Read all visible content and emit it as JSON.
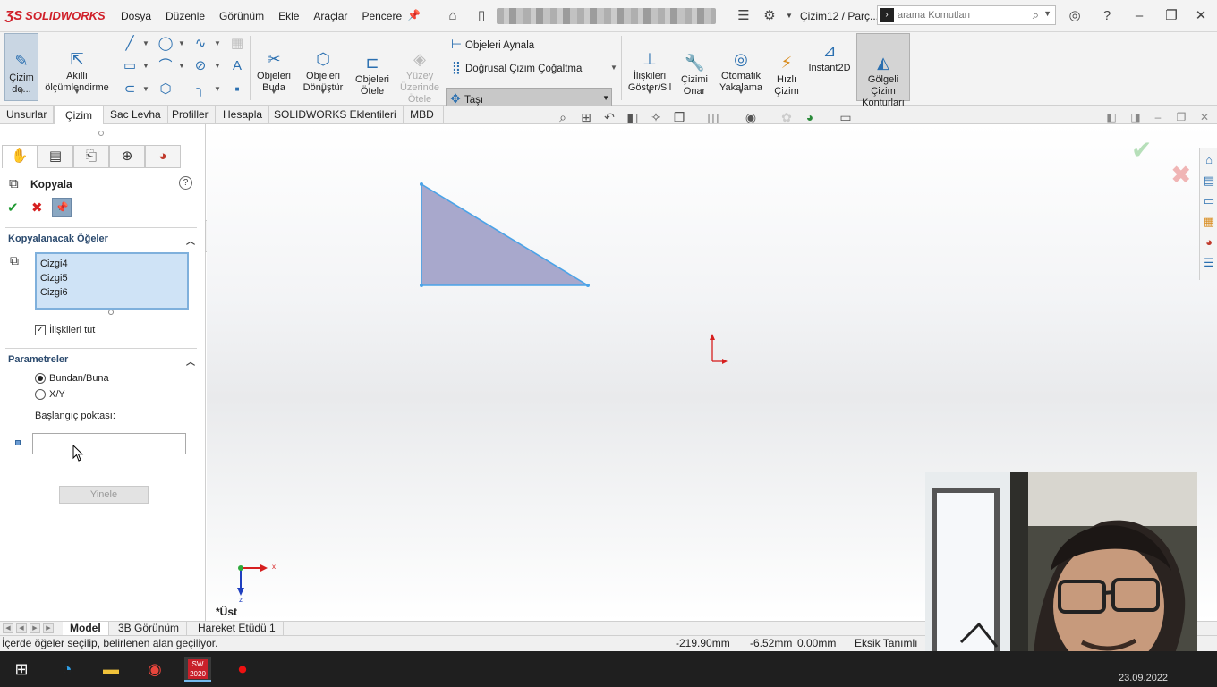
{
  "app": {
    "brand": "SOLIDWORKS",
    "brand_color": "#d0202a"
  },
  "menus": [
    "Dosya",
    "Düzenle",
    "Görünüm",
    "Ekle",
    "Araçlar",
    "Pencere"
  ],
  "titlebar": {
    "document_title": "Çizim12 / Parç...",
    "search_placeholder": "arama Komutları",
    "search_value": "arama Komutları"
  },
  "ribbon": {
    "sketch": "Çizim\nde...",
    "smart_dim": "Akıllı\nölçümlendirme",
    "trim": "Objeleri\nBuda",
    "convert": "Objeleri\nDönüştür",
    "offset": "Objeleri\nÖtele",
    "surface_offset": "Yüzey\nÜzerinde\nÖtele",
    "mirror": "Objeleri Aynala",
    "linear_pattern": "Doğrusal Çizim Çoğaltma",
    "move": "Taşı",
    "relations": "İlişkileri\nGöster/Sil",
    "repair": "Çizimi\nOnar",
    "quick_snaps": "Otomatik\nYakalama",
    "rapid": "Hızlı\nÇizim",
    "instant2d": "Instant2D",
    "shaded": "Gölgeli\nÇizim\nKonturları"
  },
  "tabs": [
    "Unsurlar",
    "Çizim",
    "Sac Levha",
    "Profiller",
    "Hesapla",
    "SOLIDWORKS Eklentileri",
    "MBD"
  ],
  "active_tab": "Çizim",
  "property_manager": {
    "title": "Kopyala",
    "section_items": "Kopyalanacak Öğeler",
    "items": [
      "Cizgi4",
      "Cizgi5",
      "Cizgi6"
    ],
    "keep_relations": "İlişkileri tut",
    "keep_relations_checked": true,
    "section_params": "Parametreler",
    "option_from_to": "Bundan/Buna",
    "option_xy": "X/Y",
    "selected_option": "Bundan/Buna",
    "start_point_label": "Başlangıç poktası:",
    "start_point_value": "",
    "repeat": "Yinele"
  },
  "viewport": {
    "view_label": "*Üst",
    "triangle_fill": "#a8a8cc",
    "triangle_stroke": "#4aa3e8",
    "origin_color": "#d61f1f"
  },
  "model_tabs": [
    "Model",
    "3B Görünüm",
    "Hareket Etüdü 1"
  ],
  "active_model_tab": "Model",
  "statusbar": {
    "message": "İçerde öğeler seçilip, belirlenen alan geçiliyor.",
    "x": "-219.90mm",
    "y": "-6.52mm",
    "z": "0.00mm",
    "state": "Eksik Tanımlı"
  },
  "taskbar": {
    "sw_badge": "2020",
    "date": "23.09.2022"
  }
}
